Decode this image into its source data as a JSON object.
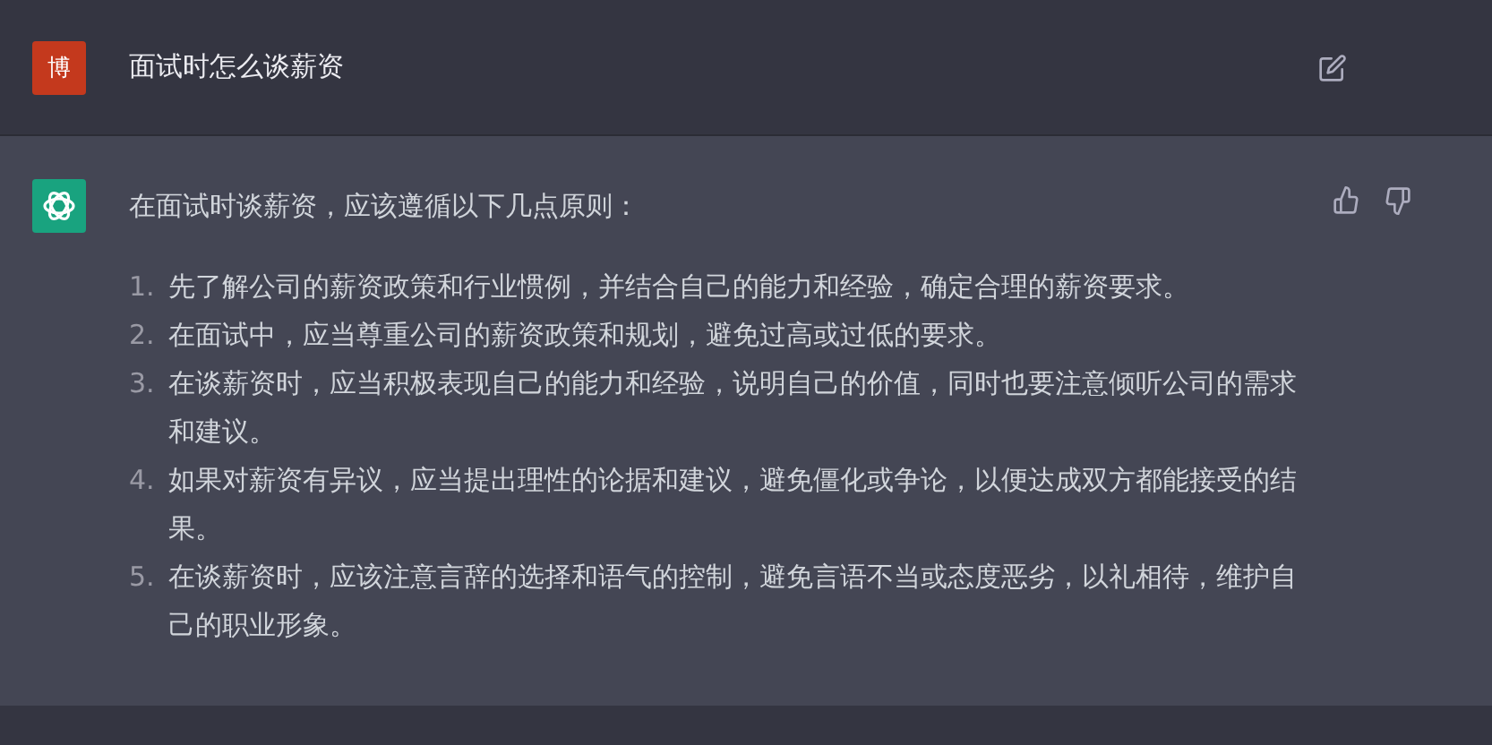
{
  "question": {
    "avatar_text": "博",
    "text": "面试时怎么谈薪资"
  },
  "answer": {
    "intro": "在面试时谈薪资，应该遵循以下几点原则：",
    "items": [
      {
        "number": "1.",
        "text": "先了解公司的薪资政策和行业惯例，并结合自己的能力和经验，确定合理的薪资要求。"
      },
      {
        "number": "2.",
        "text": "在面试中，应当尊重公司的薪资政策和规划，避免过高或过低的要求。"
      },
      {
        "number": "3.",
        "text": "在谈薪资时，应当积极表现自己的能力和经验，说明自己的价值，同时也要注意倾听公司的需求和建议。"
      },
      {
        "number": "4.",
        "text": "如果对薪资有异议，应当提出理性的论据和建议，避免僵化或争论，以便达成双方都能接受的结果。"
      },
      {
        "number": "5.",
        "text": "在谈薪资时，应该注意言辞的选择和语气的控制，避免言语不当或态度恶劣，以礼相待，维护自己的职业形象。"
      }
    ]
  }
}
